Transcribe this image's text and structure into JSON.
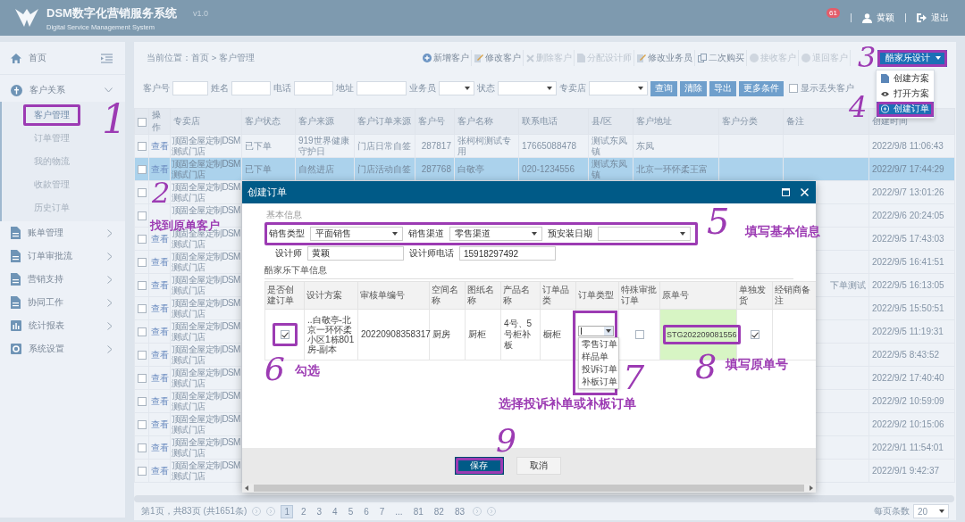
{
  "header": {
    "title": "DSM数字化营销服务系统",
    "subtitle": "Digital Service Management System",
    "version": "v1.0",
    "badge": "61",
    "user": "黄颖",
    "logout": "退出"
  },
  "sidebar": {
    "home": "首页",
    "groups": [
      {
        "label": "客户关系",
        "expanded": true,
        "children": [
          {
            "label": "客户管理",
            "selected": true,
            "annotated": true
          },
          {
            "label": "订单管理",
            "selected": false,
            "annotated": false
          },
          {
            "label": "我的物流",
            "selected": false,
            "annotated": false
          },
          {
            "label": "收款管理",
            "selected": false,
            "annotated": false
          },
          {
            "label": "历史订单",
            "selected": false,
            "annotated": false
          }
        ]
      },
      {
        "label": "账单管理",
        "expanded": false
      },
      {
        "label": "订单审批流",
        "expanded": false
      },
      {
        "label": "营销支持",
        "expanded": false
      },
      {
        "label": "协同工作",
        "expanded": false
      },
      {
        "label": "统计报表",
        "expanded": false
      },
      {
        "label": "系统设置",
        "expanded": false
      }
    ]
  },
  "breadcrumb": "当前位置：首页 > 客户管理",
  "toolbar": [
    {
      "label": "新增客户",
      "disabled": false
    },
    {
      "label": "修改客户",
      "disabled": false
    },
    {
      "label": "删除客户",
      "disabled": true
    },
    {
      "label": "分配设计师",
      "disabled": true
    },
    {
      "label": "修改业务员",
      "disabled": false
    },
    {
      "label": "二次购买",
      "disabled": false
    },
    {
      "label": "接收客户",
      "disabled": true
    },
    {
      "label": "退回客户",
      "disabled": true
    }
  ],
  "design_menu": {
    "label": "酷家乐设计",
    "annotated": true,
    "open": true,
    "items": [
      {
        "label": "创建方案",
        "selected": false,
        "annotated": false
      },
      {
        "label": "打开方案",
        "selected": false,
        "annotated": false
      },
      {
        "label": "创建订单",
        "selected": true,
        "annotated": true
      }
    ]
  },
  "filters": [
    {
      "label": "客户号",
      "kind": "text"
    },
    {
      "label": "姓名",
      "kind": "text"
    },
    {
      "label": "电话",
      "kind": "text"
    },
    {
      "label": "地址",
      "kind": "text"
    },
    {
      "label": "业务员",
      "kind": "select"
    },
    {
      "label": "状态",
      "kind": "select"
    },
    {
      "label": "专卖店",
      "kind": "select"
    }
  ],
  "filter_buttons": [
    "查询",
    "清除",
    "导出",
    "更多条件"
  ],
  "show_lost": {
    "label": "显示丢失客户",
    "checked": false
  },
  "table": {
    "all_checked": false,
    "columns": [
      "操作",
      "专卖店",
      "客户状态",
      "客户来源",
      "客户订单来源",
      "客户号",
      "客户名称",
      "联系电话",
      "县/区",
      "客户地址",
      "客户分类",
      "备注",
      "创建时间"
    ],
    "rows": [
      {
        "checked": false,
        "selected": false,
        "action": "查看",
        "store": "顶固全屋定制DSM测试门店",
        "status": "已下单",
        "source": "919世界健康守护日",
        "order_source": "门店日常自签",
        "customer_no": "287817",
        "customer_name": "张柯柯测试专用",
        "phone": "17665088478",
        "district": "测试东凤镇",
        "address": "东凤",
        "created": "2022/9/8 11:06:43"
      },
      {
        "checked": false,
        "selected": true,
        "action": "查看",
        "store": "顶固全屋定制DSM测试门店",
        "status": "已下单",
        "source": "自然进店",
        "order_source": "门店活动自签",
        "customer_no": "287768",
        "customer_name": "白敬亭",
        "phone": "020-1234556",
        "district": "测试东凤镇",
        "address": "北京一环怀柔王富",
        "created": "2022/9/7 17:44:29"
      },
      {
        "checked": false,
        "selected": false,
        "store": "顶固全屋定制DSM测试门店",
        "created": "2022/9/7 13:01:26"
      },
      {
        "checked": false,
        "selected": false,
        "store": "顶固全屋定制DSM",
        "created": "2022/9/6 20:24:05"
      },
      {
        "checked": false,
        "selected": false,
        "action": "查看",
        "store": "顶固全屋定制DSM测试门店",
        "created": "2022/9/5 17:43:03"
      },
      {
        "checked": false,
        "selected": false,
        "action": "查看",
        "store": "顶固全屋定制DSM测试门店",
        "created": "2022/9/5 16:41:51"
      },
      {
        "checked": false,
        "selected": false,
        "action": "查看",
        "store": "顶固全屋定制DSM测试门店",
        "note": "下单测试",
        "created": "2022/9/5 16:13:05"
      },
      {
        "checked": false,
        "selected": false,
        "action": "查看",
        "store": "顶固全屋定制DSM测试门店",
        "created": "2022/9/5 15:50:51"
      },
      {
        "checked": false,
        "selected": false,
        "action": "查看",
        "store": "顶固全屋定制DSM测试门店",
        "created": "2022/9/5 11:19:31"
      },
      {
        "checked": false,
        "selected": false,
        "action": "查看",
        "store": "顶固全屋定制DSM测试门店",
        "created": "2022/9/5 8:43:52"
      },
      {
        "checked": false,
        "selected": false,
        "action": "查看",
        "store": "顶固全屋定制DSM测试门店",
        "created": "2022/9/2 17:40:40"
      },
      {
        "checked": false,
        "selected": false,
        "action": "查看",
        "store": "顶固全屋定制DSM测试门店",
        "created": "2022/9/2 10:59:09"
      },
      {
        "checked": false,
        "selected": false,
        "action": "查看",
        "store": "顶固全屋定制DSM测试门店",
        "created": "2022/9/2 10:15:06"
      },
      {
        "checked": false,
        "selected": false,
        "action": "查看",
        "store": "顶固全屋定制DSM测试门店",
        "created": "2022/9/1 11:54:01"
      },
      {
        "checked": false,
        "selected": false,
        "action": "查看",
        "store": "顶固全屋定制DSM测试门店",
        "created": "2022/9/1 9:42:37"
      }
    ]
  },
  "pager": {
    "summary": "第1页，共83页 (共1651条)",
    "pages": [
      {
        "label": "1",
        "selected": true
      },
      {
        "label": "2",
        "selected": false
      },
      {
        "label": "3",
        "selected": false
      },
      {
        "label": "4",
        "selected": false
      },
      {
        "label": "5",
        "selected": false
      },
      {
        "label": "6",
        "selected": false
      },
      {
        "label": "7",
        "selected": false
      },
      {
        "label": "...",
        "selected": false
      },
      {
        "label": "81",
        "selected": false
      },
      {
        "label": "82",
        "selected": false
      },
      {
        "label": "83",
        "selected": false
      }
    ],
    "page_size_label": "每页条数",
    "page_size": "20"
  },
  "dialog": {
    "title": "创建订单",
    "basic_title": "基本信息",
    "basic_annotated": true,
    "basic_fields": [
      {
        "label": "销售类型",
        "kind": "select",
        "value": "平面销售"
      },
      {
        "label": "销售渠道",
        "kind": "select",
        "value": "零售渠道"
      },
      {
        "label": "预安装日期",
        "kind": "select"
      }
    ],
    "designer_fields": [
      {
        "label": "设计师",
        "kind": "text",
        "value": "黄颖"
      },
      {
        "label": "设计师电话",
        "kind": "text",
        "value": "15918297492"
      }
    ],
    "order_title": "酷家乐下单信息",
    "columns": [
      "是否创建订单",
      "设计方案",
      "审核单编号",
      "空间名称",
      "图纸名称",
      "产品名称",
      "订单品类",
      "订单类型",
      "特殊审批订单",
      "原单号",
      "单独发货",
      "经销商备注"
    ],
    "row": {
      "create_order": {
        "checked": true,
        "annotated": true
      },
      "scheme": "..白敬亭-北京一环怀柔小区1栋801房-副本",
      "audit_no": "20220908358317",
      "space": "厨房",
      "drawing": "厨柜",
      "product": "4号、5号柜补板",
      "category": "橱柜",
      "order_type": {
        "open": true,
        "annotated": true,
        "options": [
          "零售订单",
          "样品单",
          "投诉订单",
          "补板订单"
        ]
      },
      "special_approval": {
        "checked": false
      },
      "original_no": {
        "value": "STG202209081556",
        "annotated": true
      },
      "ship_separately": {
        "checked": true
      }
    },
    "buttons": [
      {
        "label": "保存",
        "kind": "primary",
        "annotated": true
      },
      {
        "label": "取消",
        "kind": "secondary",
        "annotated": false
      }
    ]
  },
  "annotations": [
    "1",
    "2",
    "找到原单客户",
    "3",
    "4",
    "5",
    "填写基本信息",
    "6",
    "勾选",
    "7",
    "选择投诉补单或补板订单",
    "8",
    "填写原单号",
    "9"
  ]
}
